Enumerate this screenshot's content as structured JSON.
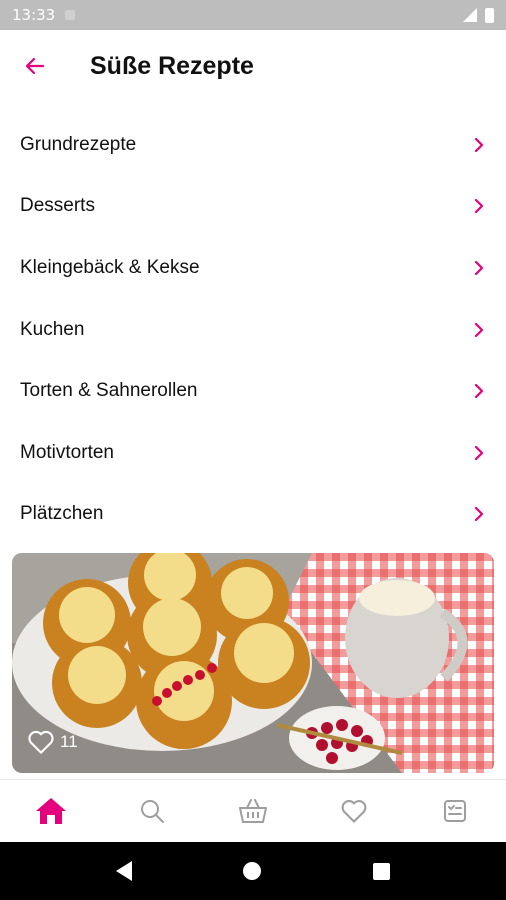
{
  "status_bar": {
    "time": "13:33"
  },
  "app_bar": {
    "title": "Süße Rezepte",
    "back_icon": "arrow-left-icon"
  },
  "menu": {
    "items": [
      {
        "label": "Grundrezepte"
      },
      {
        "label": "Desserts"
      },
      {
        "label": "Kleingebäck & Kekse"
      },
      {
        "label": "Kuchen"
      },
      {
        "label": "Torten & Sahnerollen"
      },
      {
        "label": "Motivtorten"
      },
      {
        "label": "Plätzchen"
      }
    ]
  },
  "hero": {
    "likes": "11",
    "like_icon": "heart-outline-icon"
  },
  "bottom_nav": {
    "items": [
      {
        "icon": "home-icon",
        "active": true
      },
      {
        "icon": "search-icon",
        "active": false
      },
      {
        "icon": "basket-icon",
        "active": false
      },
      {
        "icon": "heart-icon",
        "active": false
      },
      {
        "icon": "shopping-list-icon",
        "active": false
      }
    ]
  },
  "colors": {
    "accent": "#e5007d",
    "inactive": "#9e9e9e"
  }
}
